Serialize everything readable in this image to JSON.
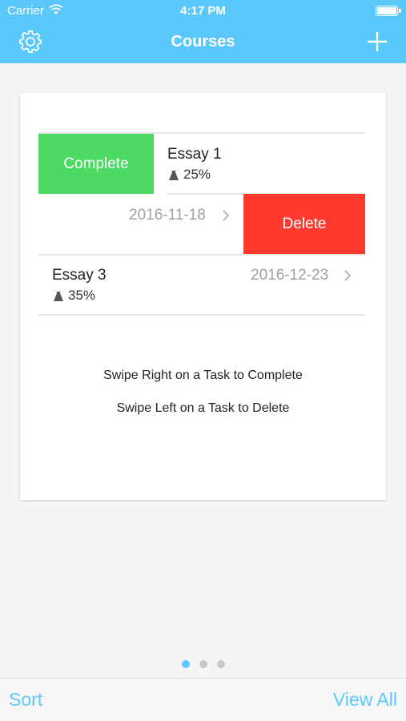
{
  "status": {
    "carrier": "Carrier",
    "time": "4:17 PM"
  },
  "nav": {
    "title": "Courses",
    "left_icon": "gear-icon",
    "right_icon": "plus-icon"
  },
  "actions": {
    "complete_label": "Complete",
    "delete_label": "Delete"
  },
  "tasks": [
    {
      "title": "Essay 1",
      "weight": "25%",
      "date": ""
    },
    {
      "title": "",
      "weight": "",
      "date": "2016-11-18"
    },
    {
      "title": "Essay 3",
      "weight": "35%",
      "date": "2016-12-23"
    }
  ],
  "hints": {
    "line1": "Swipe Right on a Task to Complete",
    "line2": "Swipe Left on a Task to Delete"
  },
  "pager": {
    "count": 3,
    "active_index": 0
  },
  "toolbar": {
    "sort_label": "Sort",
    "view_all_label": "View All"
  },
  "colors": {
    "accent": "#5bc8fb",
    "complete": "#4cd964",
    "delete": "#ff3b30",
    "date_gray": "#a0a0a0"
  }
}
